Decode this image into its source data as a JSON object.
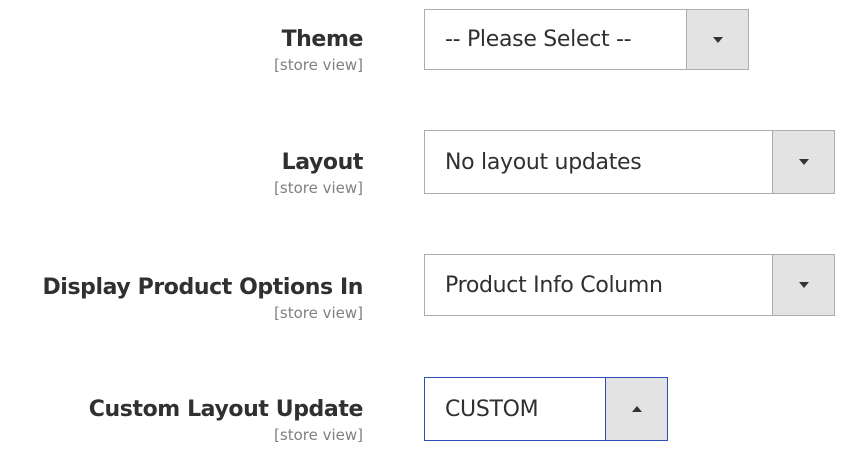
{
  "fields": [
    {
      "label": "Theme",
      "scope": "[store view]",
      "value": "-- Please Select --",
      "icon": "chevron-down-icon"
    },
    {
      "label": "Layout",
      "scope": "[store view]",
      "value": "No layout updates",
      "icon": "chevron-down-icon"
    },
    {
      "label": "Display Product Options In",
      "scope": "[store view]",
      "value": "Product Info Column",
      "icon": "chevron-down-icon"
    },
    {
      "label": "Custom Layout Update",
      "scope": "[store view]",
      "value": "CUSTOM",
      "icon": "chevron-up-icon",
      "state": "open"
    }
  ],
  "colors": {
    "label": "#303030",
    "scope": "#808080",
    "border": "#adadad",
    "button_bg": "#e3e3e3",
    "focus_border": "#2f4fb5"
  }
}
